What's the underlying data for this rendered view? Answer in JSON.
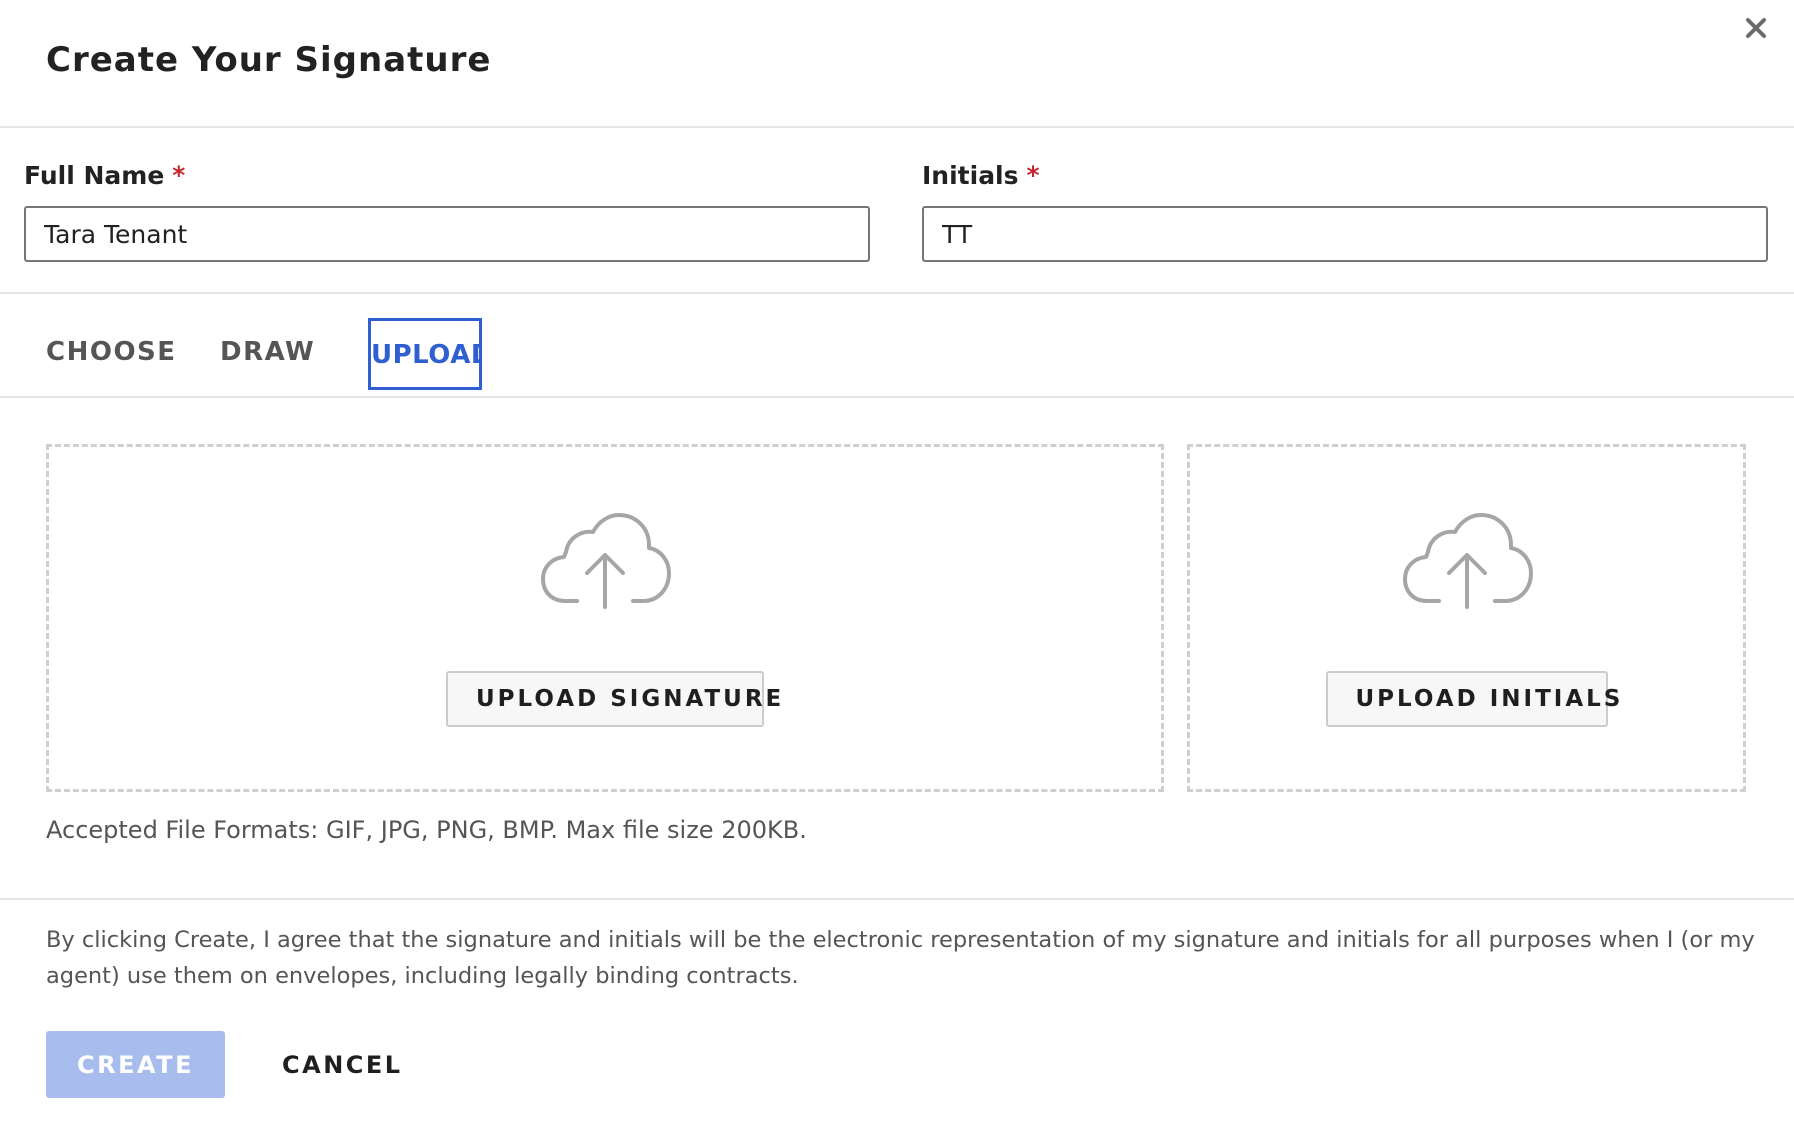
{
  "dialog": {
    "title": "Create Your Signature",
    "close_icon": "close-icon"
  },
  "fields": {
    "full_name": {
      "label": "Full Name",
      "required_marker": "*",
      "value": "Tara Tenant"
    },
    "initials": {
      "label": "Initials",
      "required_marker": "*",
      "value": "TT"
    }
  },
  "tabs": [
    {
      "label": "CHOOSE",
      "active": false
    },
    {
      "label": "DRAW",
      "active": false
    },
    {
      "label": "UPLOAD",
      "active": true
    }
  ],
  "upload": {
    "signature_button": "UPLOAD SIGNATURE",
    "initials_button": "UPLOAD INITIALS",
    "icon": "cloud-upload-icon",
    "formats_note": "Accepted File Formats: GIF, JPG, PNG, BMP. Max file size 200KB."
  },
  "agreement_text": "By clicking Create, I agree that the signature and initials will be the electronic representation of my signature and initials for all purposes when I (or my agent) use them on envelopes, including legally binding contracts.",
  "actions": {
    "create_label": "CREATE",
    "cancel_label": "CANCEL"
  },
  "colors": {
    "accent": "#2f5fd0",
    "create_disabled": "#a8bdee",
    "required": "#c4262e"
  }
}
